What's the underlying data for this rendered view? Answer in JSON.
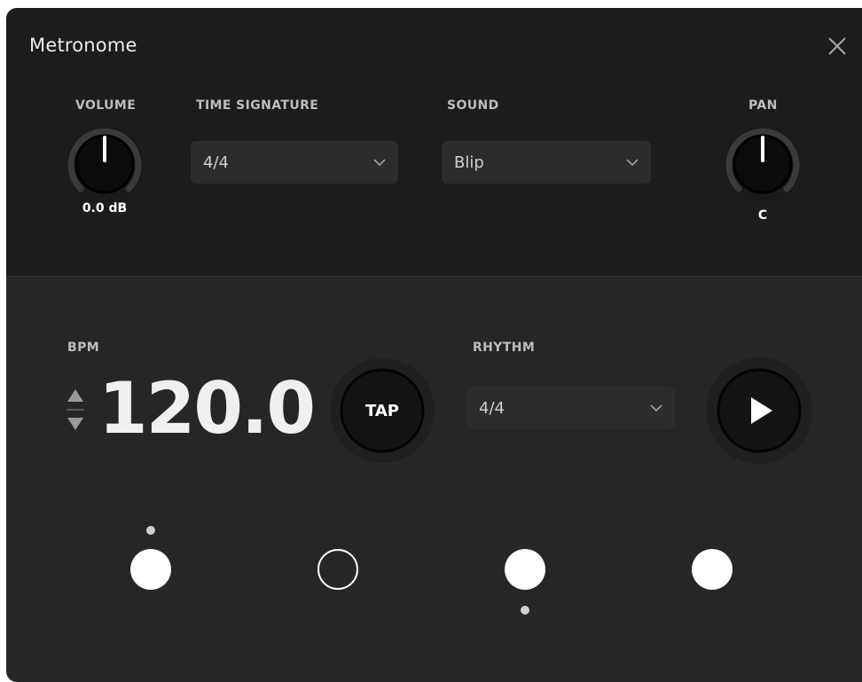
{
  "window": {
    "title": "Metronome"
  },
  "volume": {
    "label": "VOLUME",
    "value": "0.0 dB",
    "level": 0.5
  },
  "time_signature": {
    "label": "TIME SIGNATURE",
    "selected": "4/4"
  },
  "sound": {
    "label": "SOUND",
    "selected": "Blip"
  },
  "pan": {
    "label": "PAN",
    "value": "C",
    "level": 0.5
  },
  "bpm": {
    "label": "BPM",
    "value": "120.0"
  },
  "tap": {
    "label": "TAP"
  },
  "rhythm": {
    "label": "RHYTHM",
    "selected": "4/4"
  },
  "beats": [
    {
      "filled": true,
      "accent": "above"
    },
    {
      "filled": false,
      "accent": "none"
    },
    {
      "filled": true,
      "accent": "below"
    },
    {
      "filled": true,
      "accent": "none"
    }
  ],
  "colors": {
    "top_panel": "#1c1c1c",
    "bottom_panel": "#262626",
    "accent": "#ffffff"
  },
  "icons": {
    "close": "close-icon",
    "play": "play-icon",
    "chevron": "chevron-down-icon",
    "stepper_up": "triangle-up-icon",
    "stepper_down": "triangle-down-icon"
  }
}
